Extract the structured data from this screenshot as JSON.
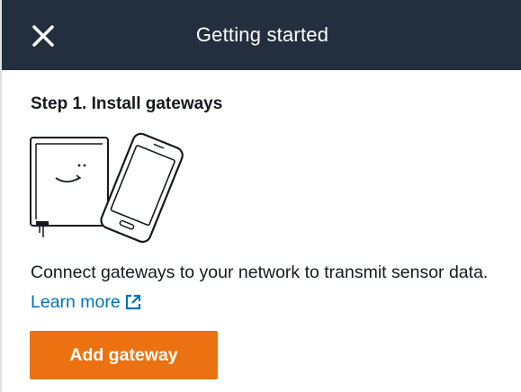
{
  "header": {
    "title": "Getting started",
    "close_icon": "close-icon"
  },
  "step": {
    "title": "Step 1. Install gateways",
    "illustration_icon": "gateway-and-phone-illustration",
    "description": "Connect gateways to your network to transmit sensor data.",
    "learn_more_label": "Learn more",
    "learn_more_icon": "external-link-icon",
    "button_label": "Add gateway"
  },
  "colors": {
    "header_bg": "#232f3e",
    "link": "#0073bb",
    "primary_button": "#ec7211"
  }
}
